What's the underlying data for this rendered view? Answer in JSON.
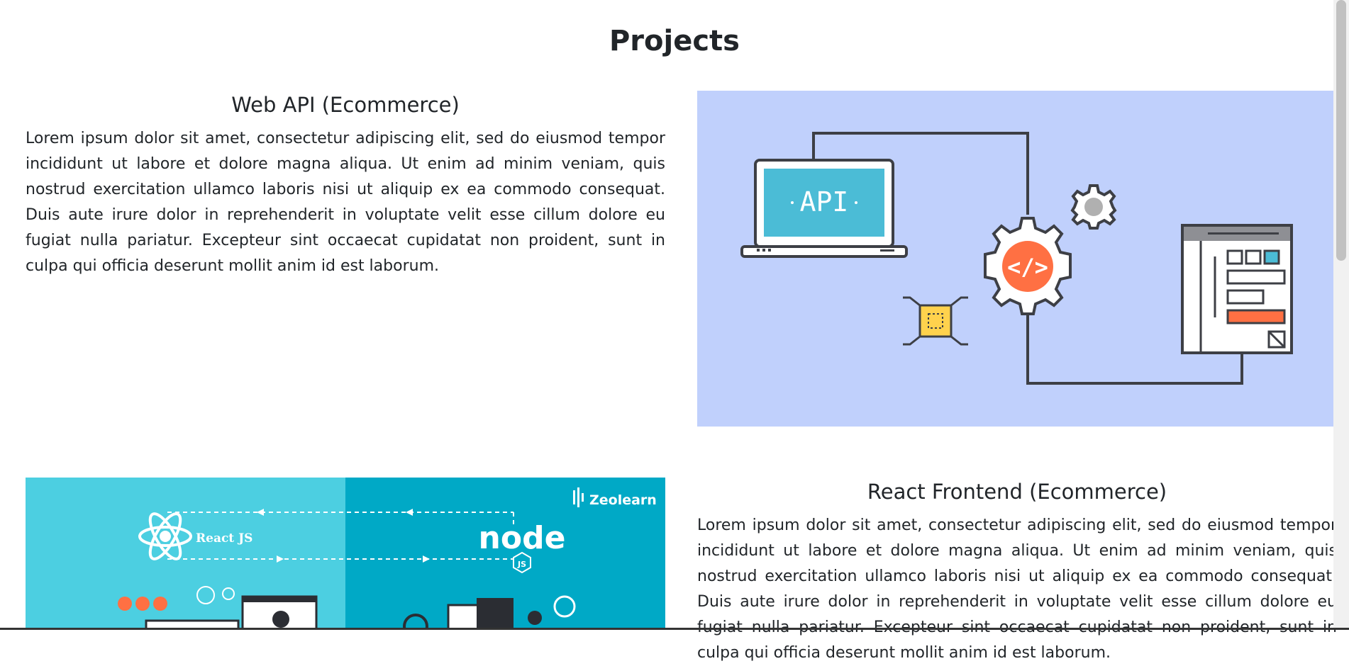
{
  "page": {
    "title": "Projects"
  },
  "projects": [
    {
      "title": "Web API (Ecommerce)",
      "description": "Lorem ipsum dolor sit amet, consectetur adipiscing elit, sed do eiusmod tempor incididunt ut labore et dolore magna aliqua. Ut enim ad minim veniam, quis nostrud exercitation ullamco laboris nisi ut aliquip ex ea commodo consequat. Duis aute irure dolor in reprehenderit in voluptate velit esse cillum dolore eu fugiat nulla pariatur. Excepteur sint occaecat cupidatat non proident, sunt in culpa qui officia deserunt mollit anim id est laborum.",
      "image": {
        "screen_text": "API",
        "background": "#c0d0fc"
      }
    },
    {
      "title": "React Frontend (Ecommerce)",
      "description": "Lorem ipsum dolor sit amet, consectetur adipiscing elit, sed do eiusmod tempor incididunt ut labore et dolore magna aliqua. Ut enim ad minim veniam, quis nostrud exercitation ullamco laboris nisi ut aliquip ex ea commodo consequat. Duis aute irure dolor in reprehenderit in voluptate velit esse cillum dolore eu fugiat nulla pariatur. Excepteur sint occaecat cupidatat non proident, sunt in culpa qui officia deserunt mollit anim id est laborum.",
      "image": {
        "left_label": "React JS",
        "right_logo": "node",
        "right_sublabel": "JS",
        "brand": "Zeolearn",
        "left_bg": "#4ccfe1",
        "right_bg": "#00a9c6"
      }
    }
  ]
}
